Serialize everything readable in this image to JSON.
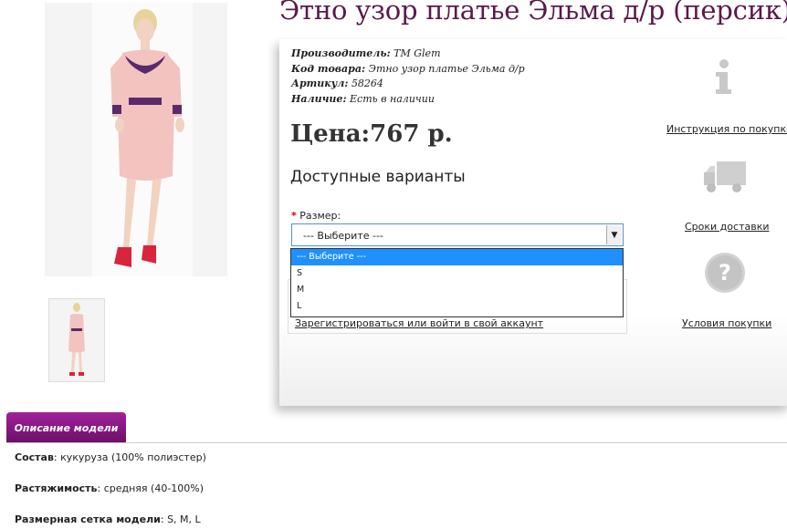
{
  "product": {
    "title": "Этно узор платье Эльма д/р (персик)",
    "info": [
      {
        "label": "Производитель",
        "value": "TM Glem"
      },
      {
        "label": "Код товара",
        "value": "Этно узор платье Эльма д/р"
      },
      {
        "label": "Артикул",
        "value": "58264"
      },
      {
        "label": "Наличие",
        "value": "Есть в наличии"
      }
    ],
    "price": "Цена:767 р.",
    "variants_heading": "Доступные варианты",
    "size_label": "Размер",
    "size_required": "*",
    "size_selected": "--- Выберите ---",
    "size_options": [
      "--- Выберите ---",
      "S",
      "M",
      "L"
    ],
    "login_link": "Зарегистрироваться или войти в свой аккаунт"
  },
  "sidebar": {
    "instructions_link": "Инструкция по покупке",
    "delivery_link": "Сроки доставки",
    "terms_link": "Условия покупки",
    "icons": [
      "info-icon",
      "truck-icon",
      "question-icon"
    ]
  },
  "description": {
    "tab": "Описание модели",
    "rows": [
      {
        "label": "Состав",
        "value": "кукуруза (100% полиэстер)"
      },
      {
        "label": "Растяжимость",
        "value": "средняя (40-100%)"
      },
      {
        "label": "Размерная сетка модели",
        "value": "S, M, L"
      }
    ]
  },
  "colors": {
    "accent": "#8b1a86",
    "title": "#5a1a4a",
    "select_highlight": "#1e90ff",
    "dress": "#f3c3c0",
    "embroidery": "#5a2a6a"
  }
}
